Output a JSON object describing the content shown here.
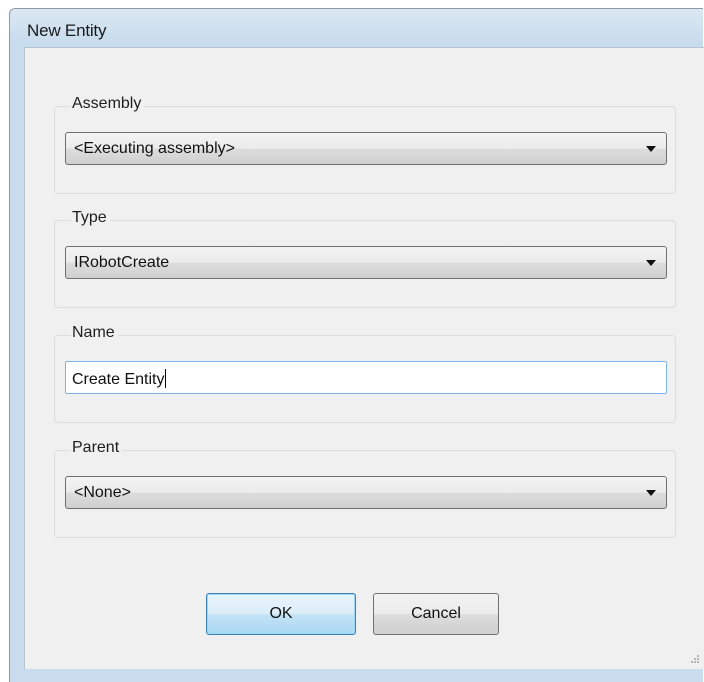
{
  "window": {
    "title": "New Entity"
  },
  "assembly": {
    "label": "Assembly",
    "value": "<Executing assembly>"
  },
  "type": {
    "label": "Type",
    "value": "IRobotCreate"
  },
  "name": {
    "label": "Name",
    "value": "Create Entity"
  },
  "parent": {
    "label": "Parent",
    "value": "<None>"
  },
  "buttons": {
    "ok": "OK",
    "cancel": "Cancel"
  },
  "icons": {
    "dropdown": "chevron-down-icon",
    "resize": "resize-grip-icon"
  }
}
